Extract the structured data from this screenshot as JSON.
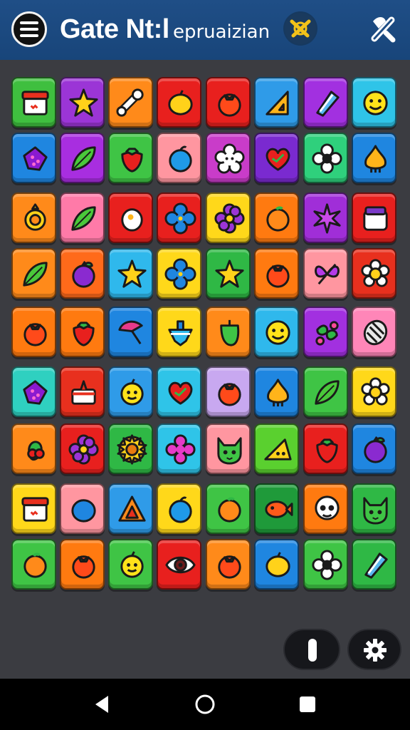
{
  "header": {
    "title_main": "Gate Nt:l",
    "title_sub": "epruaizian",
    "menu_icon": "hamburger-menu-icon",
    "logo_icon": "emblem-logo-icon",
    "tools_icon": "tools-icon"
  },
  "colors": {
    "header": "#1f4e86",
    "board": "#3b3c41",
    "navbar": "#000000"
  },
  "board": {
    "rows": [
      [
        {
          "bg": "#3fbf3f",
          "icon": "shop-stall-icon"
        },
        {
          "bg": "#9b35d6",
          "icon": "star-icon"
        },
        {
          "bg": "#ff8a1a",
          "icon": "bone-icon"
        },
        {
          "bg": "#e8201e",
          "icon": "lemon-icon"
        },
        {
          "bg": "#e8201e",
          "icon": "tomato-icon"
        },
        {
          "bg": "#2f9be8",
          "icon": "ruler-triangle-icon"
        },
        {
          "bg": "#a230e0",
          "icon": "crystal-icon"
        },
        {
          "bg": "#2fc4e8",
          "icon": "smiley-face-icon"
        }
      ],
      [
        {
          "bg": "#1f86e0",
          "icon": "berry-icon"
        },
        {
          "bg": "#a82ee0",
          "icon": "leaf-icon"
        },
        {
          "bg": "#3fc445",
          "icon": "strawberry-icon"
        },
        {
          "bg": "#ff96a0",
          "icon": "apple-icon"
        },
        {
          "bg": "#c93cc9",
          "icon": "flower-face-icon"
        },
        {
          "bg": "#7a2ad0",
          "icon": "heart-icon"
        },
        {
          "bg": "#2fd07c",
          "icon": "flower-icon"
        },
        {
          "bg": "#1f86e0",
          "icon": "onion-icon"
        }
      ],
      [
        {
          "bg": "#ff8a1a",
          "icon": "ring-icon"
        },
        {
          "bg": "#ff7aa8",
          "icon": "leaf-icon"
        },
        {
          "bg": "#e8201e",
          "icon": "egg-icon"
        },
        {
          "bg": "#e8201e",
          "icon": "blue-flower-icon"
        },
        {
          "bg": "#ffd81a",
          "icon": "purple-flower-icon"
        },
        {
          "bg": "#ff7a10",
          "icon": "orange-icon"
        },
        {
          "bg": "#a02ed8",
          "icon": "star-flower-icon"
        },
        {
          "bg": "#e8201e",
          "icon": "jar-icon"
        }
      ],
      [
        {
          "bg": "#ff8a1a",
          "icon": "leaf-icon"
        },
        {
          "bg": "#ff6a1a",
          "icon": "plum-icon"
        },
        {
          "bg": "#2fb8ec",
          "icon": "star-icon"
        },
        {
          "bg": "#ffd81a",
          "icon": "blue-flower-icon"
        },
        {
          "bg": "#2fb845",
          "icon": "star-icon"
        },
        {
          "bg": "#ff7a10",
          "icon": "tomato-icon"
        },
        {
          "bg": "#ff96a0",
          "icon": "butterfly-icon"
        },
        {
          "bg": "#e8301e",
          "icon": "daisy-icon"
        }
      ],
      [
        {
          "bg": "#ff7a10",
          "icon": "tomato-icon"
        },
        {
          "bg": "#ff7a10",
          "icon": "strawberry-icon"
        },
        {
          "bg": "#1f86e0",
          "icon": "umbrella-icon"
        },
        {
          "bg": "#ffd81a",
          "icon": "spinning-top-icon"
        },
        {
          "bg": "#ff8a1a",
          "icon": "pepper-icon"
        },
        {
          "bg": "#2fb8ec",
          "icon": "smiley-face-icon"
        },
        {
          "bg": "#a230e0",
          "icon": "leaf-flower-icon"
        },
        {
          "bg": "#ff86b8",
          "icon": "shell-icon"
        }
      ],
      [
        {
          "bg": "#2fd0c0",
          "icon": "berry-icon"
        },
        {
          "bg": "#e8301e",
          "icon": "cake-icon"
        },
        {
          "bg": "#2f9be8",
          "icon": "lemon-face-icon"
        },
        {
          "bg": "#2fc4e8",
          "icon": "heart-icon"
        },
        {
          "bg": "#c8a8f0",
          "icon": "tomato-icon"
        },
        {
          "bg": "#1f86e0",
          "icon": "onion-icon"
        },
        {
          "bg": "#3fc445",
          "icon": "leaf-icon"
        },
        {
          "bg": "#ffd81a",
          "icon": "daisy-icon"
        }
      ],
      [
        {
          "bg": "#ff8a1a",
          "icon": "cherry-icon"
        },
        {
          "bg": "#e8201e",
          "icon": "purple-flower-icon"
        },
        {
          "bg": "#2fb845",
          "icon": "sunflower-icon"
        },
        {
          "bg": "#2fc4e8",
          "icon": "pink-flower-icon"
        },
        {
          "bg": "#ff96a0",
          "icon": "cat-face-icon"
        },
        {
          "bg": "#5ad02f",
          "icon": "cheese-icon"
        },
        {
          "bg": "#e8201e",
          "icon": "strawberry-icon"
        },
        {
          "bg": "#1f86e0",
          "icon": "plum-icon"
        }
      ],
      [
        {
          "bg": "#ffd81a",
          "icon": "shop-stall-icon"
        },
        {
          "bg": "#ff96a0",
          "icon": "blueberry-icon"
        },
        {
          "bg": "#2f9be8",
          "icon": "triangle-icon"
        },
        {
          "bg": "#ffd81a",
          "icon": "apple-icon"
        },
        {
          "bg": "#3fc445",
          "icon": "orange-icon"
        },
        {
          "bg": "#1f9a3a",
          "icon": "fish-icon"
        },
        {
          "bg": "#ff7a10",
          "icon": "skull-icon"
        },
        {
          "bg": "#2fb845",
          "icon": "cat-face-icon"
        }
      ],
      [
        {
          "bg": "#3fc445",
          "icon": "orange-icon"
        },
        {
          "bg": "#ff7a10",
          "icon": "tomato-icon"
        },
        {
          "bg": "#3fc445",
          "icon": "lemon-face-icon"
        },
        {
          "bg": "#e8201e",
          "icon": "eye-icon"
        },
        {
          "bg": "#ff8a1a",
          "icon": "tomato-icon"
        },
        {
          "bg": "#1f86e0",
          "icon": "lemon-icon"
        },
        {
          "bg": "#3fc445",
          "icon": "flower-icon"
        },
        {
          "bg": "#2fb845",
          "icon": "crystal-icon"
        }
      ]
    ]
  },
  "controls": {
    "pause_icon": "pause-icon",
    "settings_icon": "gear-icon"
  },
  "navbar": {
    "back_icon": "back-icon",
    "home_icon": "home-icon",
    "recents_icon": "recents-icon"
  }
}
